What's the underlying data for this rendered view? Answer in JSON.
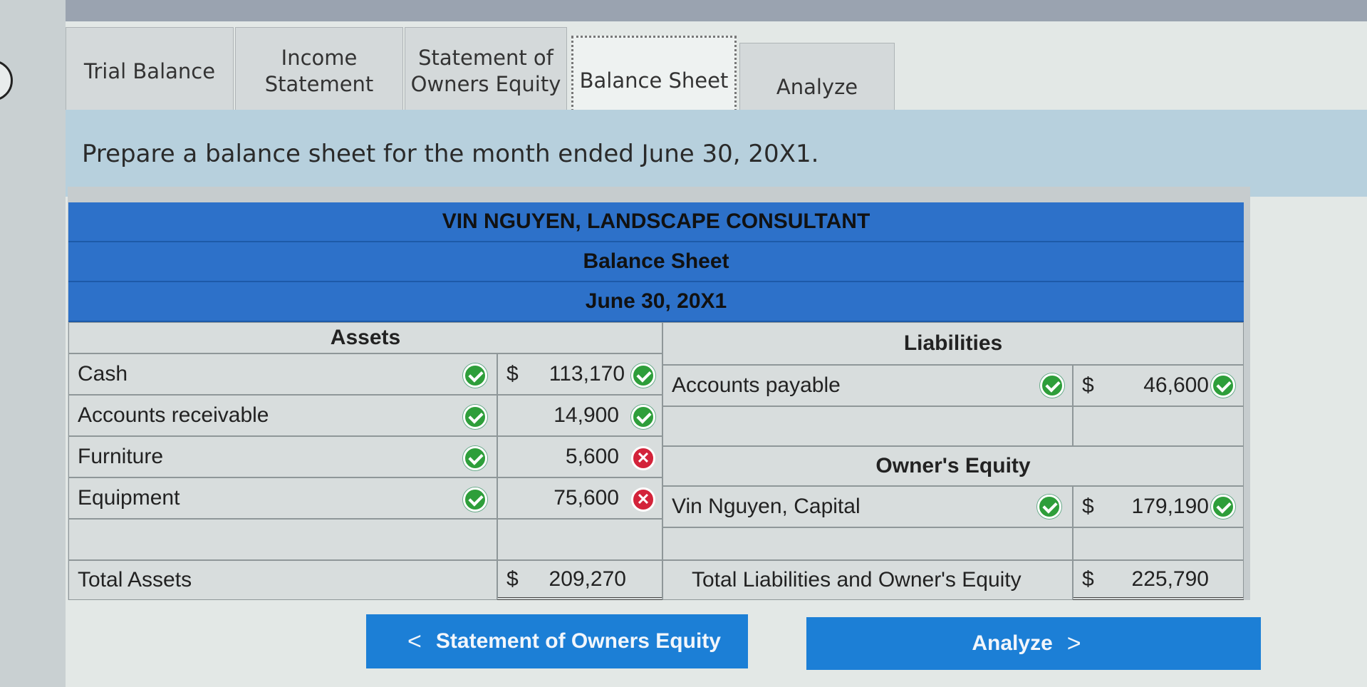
{
  "tabs": [
    {
      "label_line1": "Trial Balance",
      "label_line2": ""
    },
    {
      "label_line1": "Income",
      "label_line2": "Statement"
    },
    {
      "label_line1": "Statement of",
      "label_line2": "Owners Equity"
    },
    {
      "label_line1": "Balance Sheet",
      "label_line2": ""
    },
    {
      "label_line1": "Analyze",
      "label_line2": ""
    }
  ],
  "active_tab": "Balance Sheet",
  "prompt": "Prepare a balance sheet for the month ended June 30, 20X1.",
  "sheet": {
    "company": "VIN NGUYEN,  LANDSCAPE CONSULTANT",
    "title": "Balance Sheet",
    "date": "June 30, 20X1",
    "assets_header": "Assets",
    "liabilities_header": "Liabilities",
    "equity_header": "Owner's Equity",
    "assets": [
      {
        "label": "Cash",
        "dollar": "$",
        "amount": "113,170",
        "label_status": "correct",
        "amount_status": "correct"
      },
      {
        "label": "Accounts receivable",
        "dollar": "",
        "amount": "14,900",
        "label_status": "correct",
        "amount_status": "correct"
      },
      {
        "label": "Furniture",
        "dollar": "",
        "amount": "5,600",
        "label_status": "correct",
        "amount_status": "incorrect"
      },
      {
        "label": "Equipment",
        "dollar": "",
        "amount": "75,600",
        "label_status": "correct",
        "amount_status": "incorrect"
      }
    ],
    "liabilities": [
      {
        "label": "Accounts payable",
        "dollar": "$",
        "amount": "46,600",
        "label_status": "correct",
        "amount_status": "correct"
      }
    ],
    "equity": [
      {
        "label": "Vin Nguyen, Capital",
        "dollar": "$",
        "amount": "179,190",
        "label_status": "correct",
        "amount_status": "correct"
      }
    ],
    "total_assets_label": "Total Assets",
    "total_assets_dollar": "$",
    "total_assets": "209,270",
    "total_le_label": "Total Liabilities and Owner's Equity",
    "total_le_dollar": "$",
    "total_le": "225,790"
  },
  "nav": {
    "prev_label": "Statement of Owners Equity",
    "next_label": "Analyze",
    "prev_icon": "<",
    "next_icon": ">"
  },
  "colors": {
    "header_blue": "#2d71c9",
    "button_blue": "#1c7fd6",
    "correct_green": "#2e9e3a",
    "incorrect_red": "#d3233a"
  }
}
